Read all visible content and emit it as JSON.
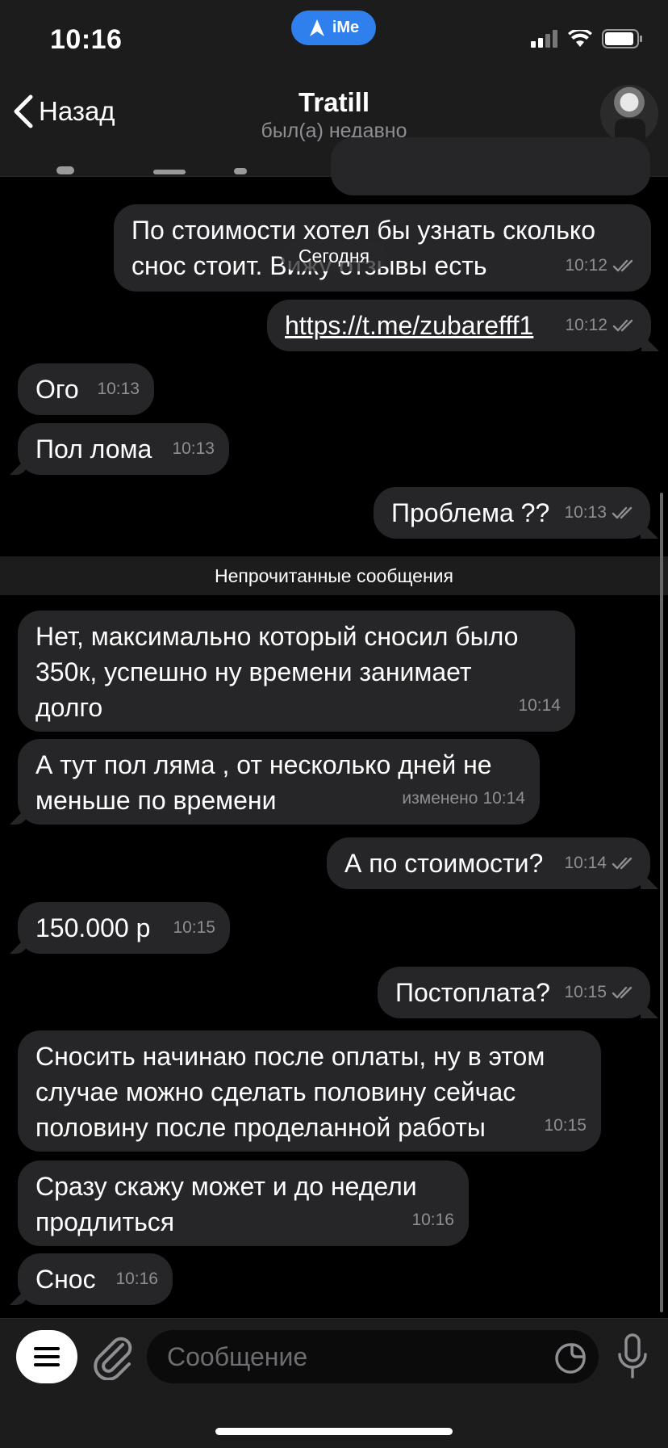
{
  "status": {
    "time": "10:16",
    "app_badge": "iMe"
  },
  "header": {
    "back_label": "Назад",
    "title": "Tratill",
    "subtitle": "был(а) недавно"
  },
  "date_pill": "Сегодня",
  "unread_divider": "Непрочитанные сообщения",
  "messages": [
    {
      "dir": "out",
      "text": "По стоимости хотел бы узнать сколько снос стоит. Вижу отзывы есть",
      "time": "10:12",
      "read": true
    },
    {
      "dir": "out",
      "text": "https://t.me/zubarefff1",
      "time": "10:12",
      "read": true,
      "link": true
    },
    {
      "dir": "in",
      "text": "Ого",
      "time": "10:13"
    },
    {
      "dir": "in",
      "text": "Пол лома",
      "time": "10:13"
    },
    {
      "dir": "out",
      "text": "Проблема ??",
      "time": "10:13",
      "read": true
    },
    {
      "dir": "in",
      "text": "Нет, максимально который сносил было 350к, успешно ну времени занимает долго",
      "time": "10:14"
    },
    {
      "dir": "in",
      "text": "А тут пол ляма , от несколько дней не меньше по времени",
      "time": "10:14",
      "edited": "изменено"
    },
    {
      "dir": "out",
      "text": "А по стоимости?",
      "time": "10:14",
      "read": true
    },
    {
      "dir": "in",
      "text": "150.000 р",
      "time": "10:15"
    },
    {
      "dir": "out",
      "text": "Постоплата?",
      "time": "10:15",
      "read": true
    },
    {
      "dir": "in",
      "text": "Сносить начинаю после оплаты, ну в этом случае можно сделать половину сейчас половину после проделанной работы",
      "time": "10:15"
    },
    {
      "dir": "in",
      "text": "Сразу скажу может и до недели продлиться",
      "time": "10:16"
    },
    {
      "dir": "in",
      "text": "Снос",
      "time": "10:16"
    }
  ],
  "composer": {
    "placeholder": "Сообщение"
  },
  "icons": [
    "back-chevron-icon",
    "signal-icon",
    "wifi-icon",
    "battery-icon",
    "menu-icon",
    "paperclip-icon",
    "sticker-icon",
    "microphone-icon",
    "double-check-icon"
  ]
}
